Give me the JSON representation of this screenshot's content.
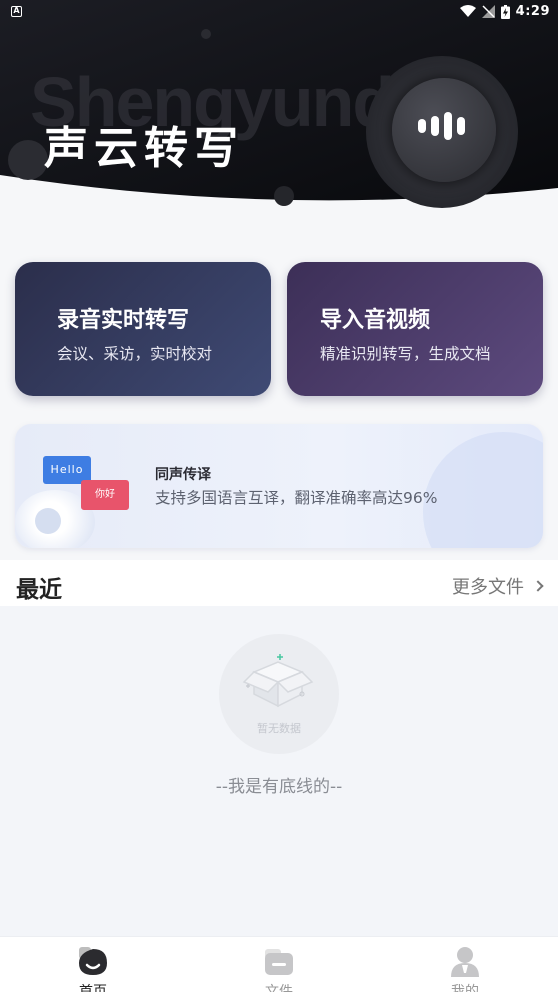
{
  "status_bar": {
    "app_indicator": "A",
    "time": "4:29"
  },
  "hero": {
    "watermark": "Shengyund",
    "title": "声云转写"
  },
  "cards": [
    {
      "title": "录音实时转写",
      "subtitle": "会议、采访，实时校对"
    },
    {
      "title": "导入音视频",
      "subtitle": "精准识别转写，生成文档"
    }
  ],
  "banner": {
    "hello": "Hello",
    "nihao": "你好",
    "title": "同声传译",
    "subtitle": "支持多国语言互译，翻译准确率高达96%"
  },
  "recent": {
    "title": "最近",
    "more": "更多文件",
    "empty": "暂无数据",
    "bottom_line": "--我是有底线的--"
  },
  "nav": {
    "home": "首页",
    "files": "文件",
    "mine": "我的"
  },
  "colors": {
    "hero_bg": "#0f1015",
    "card_record": "#333a5e",
    "card_import": "#4a3b68",
    "banner_hello": "#3e7de3",
    "banner_nihao": "#e8546b"
  }
}
